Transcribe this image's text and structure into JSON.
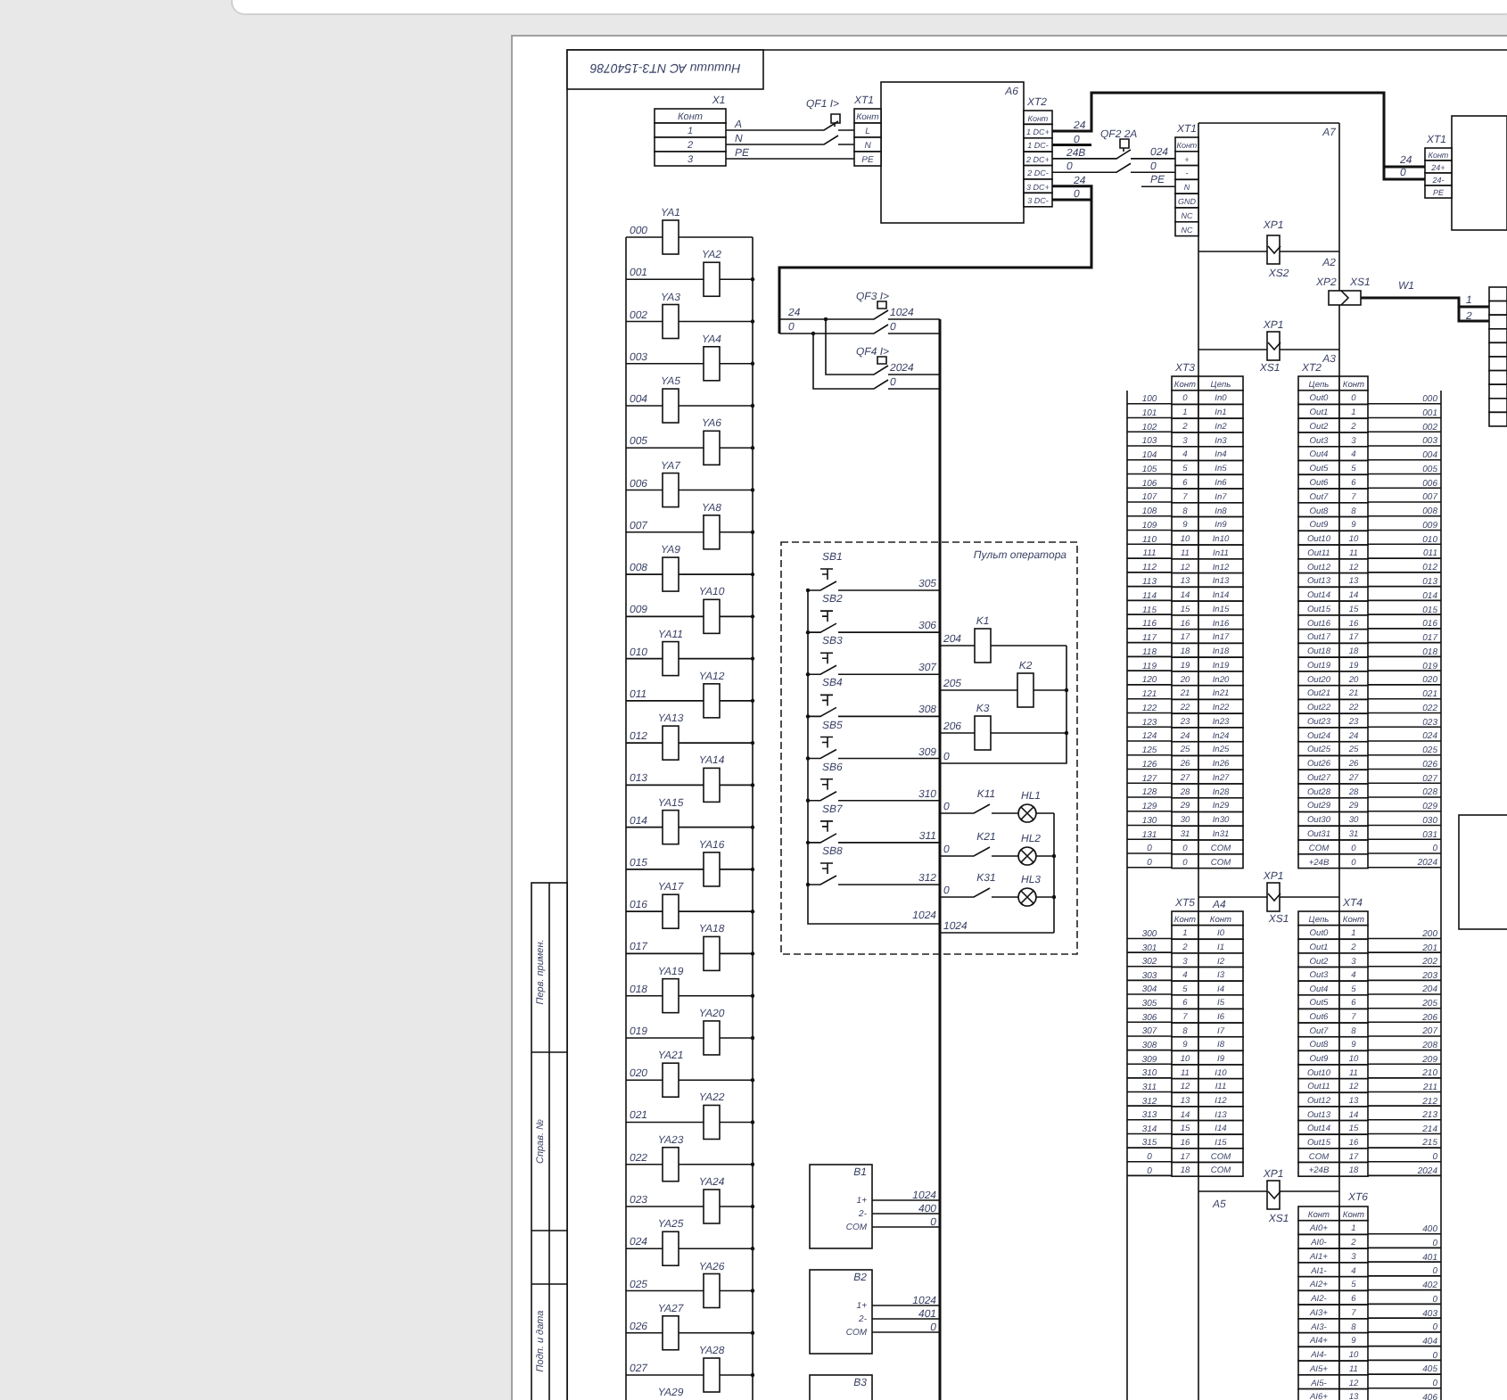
{
  "document": {
    "title": "Нишиши АС NT3-1540786",
    "margin_fields": [
      "Перв. примен.",
      "Справ. №",
      "Подп. и дата"
    ]
  },
  "power": {
    "x1": {
      "label": "X1",
      "cells": [
        "Конт",
        "1",
        "2",
        "3"
      ],
      "wires": [
        "A",
        "N",
        "PE"
      ]
    },
    "qf1": "QF1 I>",
    "a6": {
      "label": "A6",
      "input": {
        "label": "XT1",
        "cells": [
          "Конт",
          "L",
          "N",
          "PE"
        ]
      },
      "output": {
        "label": "XT2",
        "cells": [
          "Конт",
          "1 DC+",
          "1 DC-",
          "2 DC+",
          "2 DC-",
          "3 DC+",
          "3 DC-"
        ]
      },
      "wires": [
        "24",
        "0",
        "24В",
        "0",
        "24",
        "0"
      ]
    },
    "qf2": "QF2 2A",
    "a7": {
      "label": "A7",
      "wires": [
        "024",
        "0",
        "PE"
      ],
      "input": {
        "label": "XT1",
        "cells": [
          "Конт",
          "+",
          "-",
          "N",
          "GND",
          "NC",
          "NC"
        ]
      },
      "link": {
        "plug": "XP1",
        "socket": "XS2",
        "module": "A2"
      }
    },
    "bus_link": {
      "plug": "XP2",
      "socket": "XS1",
      "cable": "W1",
      "pins": [
        "1",
        "2"
      ]
    },
    "psu2": {
      "label": "XT1",
      "cells": [
        "Конт",
        "24+",
        "24-",
        "PE"
      ],
      "wires": [
        "24",
        "0"
      ]
    }
  },
  "valves": {
    "wires": [
      "000",
      "001",
      "002",
      "003",
      "004",
      "005",
      "006",
      "007",
      "008",
      "009",
      "010",
      "011",
      "012",
      "013",
      "014",
      "015",
      "016",
      "017",
      "018",
      "019",
      "020",
      "021",
      "022",
      "023",
      "024",
      "025",
      "026",
      "027"
    ],
    "coils": [
      "YA1",
      "YA2",
      "YA3",
      "YA4",
      "YA5",
      "YA6",
      "YA7",
      "YA8",
      "YA9",
      "YA10",
      "YA11",
      "YA12",
      "YA13",
      "YA14",
      "YA15",
      "YA16",
      "YA17",
      "YA18",
      "YA19",
      "YA20",
      "YA21",
      "YA22",
      "YA23",
      "YA24",
      "YA25",
      "YA26",
      "YA27",
      "YA28",
      "YA29"
    ]
  },
  "breakers": {
    "wires": [
      "24",
      "0"
    ],
    "items": [
      {
        "label": "QF3 I>",
        "wires": [
          "1024",
          "0"
        ]
      },
      {
        "label": "QF4 I>",
        "wires": [
          "2024",
          "0"
        ]
      }
    ]
  },
  "console": {
    "title": "Пульт оператора",
    "buttons": [
      {
        "label": "SB1",
        "wire": "305"
      },
      {
        "label": "SB2",
        "wire": "306"
      },
      {
        "label": "SB3",
        "wire": "307"
      },
      {
        "label": "SB4",
        "wire": "308"
      },
      {
        "label": "SB5",
        "wire": "309"
      },
      {
        "label": "SB6",
        "wire": "310"
      },
      {
        "label": "SB7",
        "wire": "311"
      },
      {
        "label": "SB8",
        "wire": "312"
      }
    ],
    "relays": [
      {
        "label": "K1",
        "wire": "204"
      },
      {
        "label": "K2",
        "wire": "205"
      },
      {
        "label": "K3",
        "wire": "206"
      }
    ],
    "relay_return": "0",
    "lamps": [
      {
        "contact": "K11",
        "lamp": "HL1",
        "wire": "0"
      },
      {
        "contact": "K21",
        "lamp": "HL2",
        "wire": "0"
      },
      {
        "contact": "K31",
        "lamp": "HL3",
        "wire": "0"
      }
    ],
    "common_wires": [
      "1024",
      "1024"
    ]
  },
  "sensors": [
    {
      "label": "B1",
      "pins": [
        "1+",
        "2-",
        "COM"
      ],
      "wires": [
        "1024",
        "400",
        "0"
      ]
    },
    {
      "label": "B2",
      "pins": [
        "1+",
        "2-",
        "COM"
      ],
      "wires": [
        "1024",
        "401",
        "0"
      ]
    },
    {
      "label": "B3"
    }
  ],
  "io_modules": [
    {
      "link": {
        "plug": "XP1",
        "socket": "XS1",
        "module": "A3"
      },
      "left_terminal": {
        "label": "XT3",
        "header": [
          "Конт",
          "Цепь"
        ],
        "rows": [
          [
            "0",
            "In0"
          ],
          [
            "1",
            "In1"
          ],
          [
            "2",
            "In2"
          ],
          [
            "3",
            "In3"
          ],
          [
            "4",
            "In4"
          ],
          [
            "5",
            "In5"
          ],
          [
            "6",
            "In6"
          ],
          [
            "7",
            "In7"
          ],
          [
            "8",
            "In8"
          ],
          [
            "9",
            "In9"
          ],
          [
            "10",
            "In10"
          ],
          [
            "11",
            "In11"
          ],
          [
            "12",
            "In12"
          ],
          [
            "13",
            "In13"
          ],
          [
            "14",
            "In14"
          ],
          [
            "15",
            "In15"
          ],
          [
            "16",
            "In16"
          ],
          [
            "17",
            "In17"
          ],
          [
            "18",
            "In18"
          ],
          [
            "19",
            "In19"
          ],
          [
            "20",
            "In20"
          ],
          [
            "21",
            "In21"
          ],
          [
            "22",
            "In22"
          ],
          [
            "23",
            "In23"
          ],
          [
            "24",
            "In24"
          ],
          [
            "25",
            "In25"
          ],
          [
            "26",
            "In26"
          ],
          [
            "27",
            "In27"
          ],
          [
            "28",
            "In28"
          ],
          [
            "29",
            "In29"
          ],
          [
            "30",
            "In30"
          ],
          [
            "31",
            "In31"
          ],
          [
            "0",
            "COM"
          ],
          [
            "0",
            "COM"
          ]
        ]
      },
      "left_wires": [
        "100",
        "101",
        "102",
        "103",
        "104",
        "105",
        "106",
        "107",
        "108",
        "109",
        "110",
        "111",
        "112",
        "113",
        "114",
        "115",
        "116",
        "117",
        "118",
        "119",
        "120",
        "121",
        "122",
        "123",
        "124",
        "125",
        "126",
        "127",
        "128",
        "129",
        "130",
        "131",
        "0",
        "0"
      ],
      "right_terminal": {
        "label": "XT2",
        "header": [
          "Цепь",
          "Конт"
        ],
        "rows": [
          [
            "Out0",
            "0"
          ],
          [
            "Out1",
            "1"
          ],
          [
            "Out2",
            "2"
          ],
          [
            "Out3",
            "3"
          ],
          [
            "Out4",
            "4"
          ],
          [
            "Out5",
            "5"
          ],
          [
            "Out6",
            "6"
          ],
          [
            "Out7",
            "7"
          ],
          [
            "Out8",
            "8"
          ],
          [
            "Out9",
            "9"
          ],
          [
            "Out10",
            "10"
          ],
          [
            "Out11",
            "11"
          ],
          [
            "Out12",
            "12"
          ],
          [
            "Out13",
            "13"
          ],
          [
            "Out14",
            "14"
          ],
          [
            "Out15",
            "15"
          ],
          [
            "Out16",
            "16"
          ],
          [
            "Out17",
            "17"
          ],
          [
            "Out18",
            "18"
          ],
          [
            "Out19",
            "19"
          ],
          [
            "Out20",
            "20"
          ],
          [
            "Out21",
            "21"
          ],
          [
            "Out22",
            "22"
          ],
          [
            "Out23",
            "23"
          ],
          [
            "Out24",
            "24"
          ],
          [
            "Out25",
            "25"
          ],
          [
            "Out26",
            "26"
          ],
          [
            "Out27",
            "27"
          ],
          [
            "Out28",
            "28"
          ],
          [
            "Out29",
            "29"
          ],
          [
            "Out30",
            "30"
          ],
          [
            "Out31",
            "31"
          ],
          [
            "COM",
            "0"
          ],
          [
            "+24В",
            "0"
          ]
        ]
      },
      "right_wires": [
        "000",
        "001",
        "002",
        "003",
        "004",
        "005",
        "006",
        "007",
        "008",
        "009",
        "010",
        "011",
        "012",
        "013",
        "014",
        "015",
        "016",
        "017",
        "018",
        "019",
        "020",
        "021",
        "022",
        "023",
        "024",
        "025",
        "026",
        "027",
        "028",
        "029",
        "030",
        "031",
        "0",
        "2024"
      ]
    },
    {
      "link": {
        "plug": "XP1",
        "socket": "XS1",
        "module": "A4"
      },
      "left_terminal": {
        "label": "XT5",
        "header": [
          "Конт",
          "Конт"
        ],
        "rows": [
          [
            "1",
            "I0"
          ],
          [
            "2",
            "I1"
          ],
          [
            "3",
            "I2"
          ],
          [
            "4",
            "I3"
          ],
          [
            "5",
            "I4"
          ],
          [
            "6",
            "I5"
          ],
          [
            "7",
            "I6"
          ],
          [
            "8",
            "I7"
          ],
          [
            "9",
            "I8"
          ],
          [
            "10",
            "I9"
          ],
          [
            "11",
            "I10"
          ],
          [
            "12",
            "I11"
          ],
          [
            "13",
            "I12"
          ],
          [
            "14",
            "I13"
          ],
          [
            "15",
            "I14"
          ],
          [
            "16",
            "I15"
          ],
          [
            "17",
            "COM"
          ],
          [
            "18",
            "COM"
          ]
        ]
      },
      "left_wires": [
        "300",
        "301",
        "302",
        "303",
        "304",
        "305",
        "306",
        "307",
        "308",
        "309",
        "310",
        "311",
        "312",
        "313",
        "314",
        "315",
        "0",
        "0"
      ],
      "right_terminal": {
        "label": "XT4",
        "header": [
          "Цепь",
          "Конт"
        ],
        "rows": [
          [
            "Out0",
            "1"
          ],
          [
            "Out1",
            "2"
          ],
          [
            "Out2",
            "3"
          ],
          [
            "Out3",
            "4"
          ],
          [
            "Out4",
            "5"
          ],
          [
            "Out5",
            "6"
          ],
          [
            "Out6",
            "7"
          ],
          [
            "Out7",
            "8"
          ],
          [
            "Out8",
            "9"
          ],
          [
            "Out9",
            "10"
          ],
          [
            "Out10",
            "11"
          ],
          [
            "Out11",
            "12"
          ],
          [
            "Out12",
            "13"
          ],
          [
            "Out13",
            "14"
          ],
          [
            "Out14",
            "15"
          ],
          [
            "Out15",
            "16"
          ],
          [
            "COM",
            "17"
          ],
          [
            "+24В",
            "18"
          ]
        ]
      },
      "right_wires": [
        "200",
        "201",
        "202",
        "203",
        "204",
        "205",
        "206",
        "207",
        "208",
        "209",
        "210",
        "211",
        "212",
        "213",
        "214",
        "215",
        "0",
        "2024"
      ]
    },
    {
      "link": {
        "plug": "XP1",
        "socket": "XS1",
        "module": "A5"
      },
      "right_terminal": {
        "label": "XT6",
        "header": [
          "Конт",
          "Конт"
        ],
        "rows": [
          [
            "AI0+",
            "1"
          ],
          [
            "AI0-",
            "2"
          ],
          [
            "AI1+",
            "3"
          ],
          [
            "AI1-",
            "4"
          ],
          [
            "AI2+",
            "5"
          ],
          [
            "AI2-",
            "6"
          ],
          [
            "AI3+",
            "7"
          ],
          [
            "AI3-",
            "8"
          ],
          [
            "AI4+",
            "9"
          ],
          [
            "AI4-",
            "10"
          ],
          [
            "AI5+",
            "11"
          ],
          [
            "AI5-",
            "12"
          ],
          [
            "AI6+",
            "13"
          ]
        ]
      },
      "right_wires": [
        "400",
        "0",
        "401",
        "0",
        "402",
        "0",
        "403",
        "0",
        "404",
        "0",
        "405",
        "0",
        "406"
      ]
    }
  ]
}
